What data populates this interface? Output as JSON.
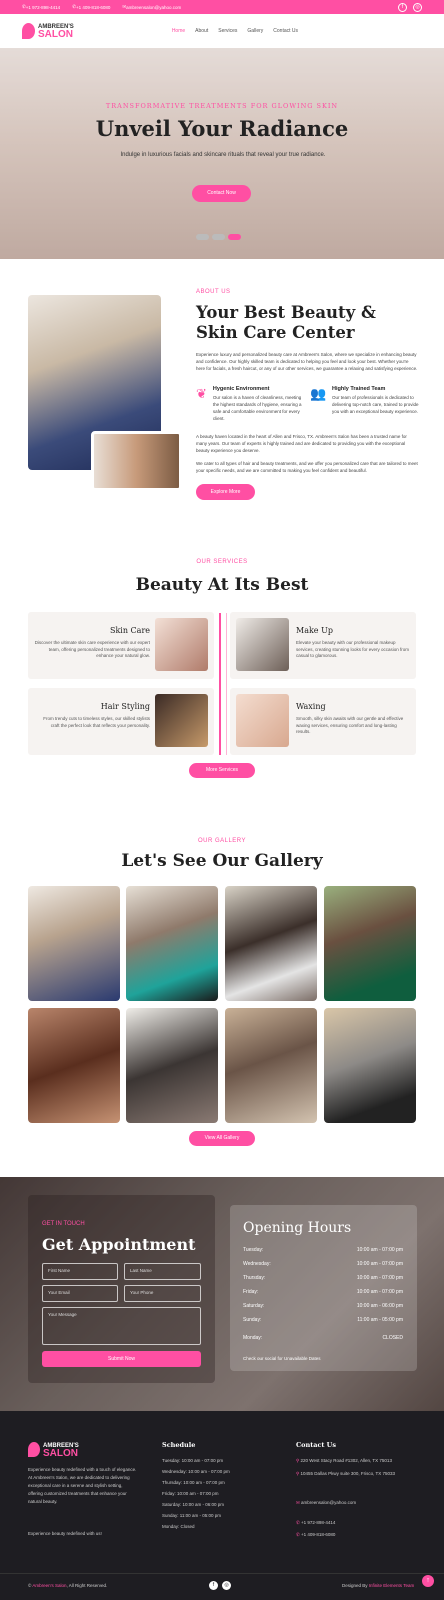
{
  "topbar": {
    "phone1": "+1 972-898-4414",
    "phone2": "+1 409-818-6080",
    "email": "ambreensalon@yahoo.com"
  },
  "nav": {
    "logo_line1": "AMBREEN'S",
    "logo_line2": "SALON",
    "items": [
      "Home",
      "About",
      "Services",
      "Gallery",
      "Contact Us"
    ],
    "active": "Home"
  },
  "hero": {
    "tagline": "TRANSFORMATIVE TREATMENTS FOR GLOWING SKIN",
    "title": "Unveil Your Radiance",
    "subtitle": "Indulge in luxurious facials and skincare rituals that reveal your true radiance.",
    "cta": "Contact Now"
  },
  "about": {
    "tag": "ABOUT US",
    "title": "Your Best Beauty & Skin Care Center",
    "p1": "Experience luxury and personalized beauty care at Ambreen's Salon, where we specialize in enhancing beauty and confidence. Our highly skilled team is dedicated to helping you feel and look your best. Whether you're here for facials, a fresh haircut, or any of our other services, we guarantee a relaxing and satisfying experience.",
    "f1_title": "Hygenic Environment",
    "f1_text": "Our salon is a haven of cleanliness, meeting the highest standards of hygiene, ensuring a safe and comfortable environment for every client.",
    "f2_title": "Highly Trained Team",
    "f2_text": "Our team of professionals is dedicated to delivering top-notch care, trained to provide you with an exceptional beauty experience.",
    "p2": "A beauty haven located in the heart of Allen and Frisco, TX. Ambreen's Salon has been a trusted name for many years. Our team of experts is highly trained and are dedicated to providing you with the exceptional beauty experience you deserve.",
    "p3": "We cater to all types of hair and beauty treatments, and we offer you personalized care that are tailored to meet your specific needs, and we are committed to making you feel confident and beautiful.",
    "cta": "Explore More"
  },
  "services": {
    "tag": "OUR SERVICES",
    "title": "Beauty At Its Best",
    "items": [
      {
        "title": "Skin Care",
        "text": "Discover the ultimate skin care experience with our expert team, offering personalized treatments designed to enhance your natural glow."
      },
      {
        "title": "Make Up",
        "text": "Elevate your beauty with our professional makeup services, creating stunning looks for every occasion from casual to glamorous."
      },
      {
        "title": "Hair Styling",
        "text": "From trendy cuts to timeless styles, our skilled stylists craft the perfect look that reflects your personality."
      },
      {
        "title": "Waxing",
        "text": "Smooth, silky skin awaits with our gentle and effective waxing services, ensuring comfort and long-lasting results."
      }
    ],
    "cta": "More Services"
  },
  "gallery": {
    "tag": "OUR GALLERY",
    "title": "Let's See Our Gallery",
    "cta": "View All Gallery"
  },
  "appointment": {
    "tag": "GET IN TOUCH",
    "title": "Get Appointment",
    "first": "First Name",
    "last": "Last Name",
    "email": "Your Email",
    "phone": "Your Phone",
    "message": "Your Message",
    "submit": "Submit Now"
  },
  "hours": {
    "title": "Opening Hours",
    "rows": [
      {
        "day": "Tuesday:",
        "time": "10:00 am - 07:00 pm"
      },
      {
        "day": "Wednesday:",
        "time": "10:00 am - 07:00 pm"
      },
      {
        "day": "Thursday:",
        "time": "10:00 am - 07:00 pm"
      },
      {
        "day": "Friday:",
        "time": "10:00 am - 07:00 pm"
      },
      {
        "day": "Saturday:",
        "time": "10:00 am - 06:00 pm"
      },
      {
        "day": "Sunday:",
        "time": "11:00 am - 05:00 pm"
      },
      {
        "day": "Monday:",
        "time": "CLOSED"
      }
    ],
    "note": "Check our social for Unavailable Dates"
  },
  "footer": {
    "about": "Experience beauty redefined with a touch of elegance. At Ambreen's Salon, we are dedicated to delivering exceptional care in a serene and stylish setting, offering customized treatments that enhance your natural beauty.",
    "motto": "Experience beauty redefined with us!",
    "schedule_h": "Schedule",
    "schedule": [
      "Tuesday: 10:00 am - 07:00 pm",
      "Wednesday: 10:00 am - 07:00 pm",
      "Thursday: 10:00 am - 07:00 pm",
      "Friday: 10:00 am - 07:00 pm",
      "Saturday: 10:00 am - 06:00 pm",
      "Sunday: 11:00 am - 05:00 pm",
      "Monday: Closed"
    ],
    "contact_h": "Contact Us",
    "addr1": "220 West Stacy Road #1302, Allen, TX 75013",
    "addr2": "10455 Dallas Pkwy suite 300, Frisco, TX 75033",
    "email": "ambreensalon@yahoo.com",
    "phone1": "+1 972-898-4414",
    "phone2": "+1 409-818-6080",
    "copy_brand": "Ambreen's Salon",
    "copy_rest": ", All Right Reserved.",
    "designed": "Designed By",
    "designer": "Infinite Elements Team"
  },
  "colors": {
    "accent": "#ff4fa3",
    "footer_bg": "#1e1d22"
  }
}
